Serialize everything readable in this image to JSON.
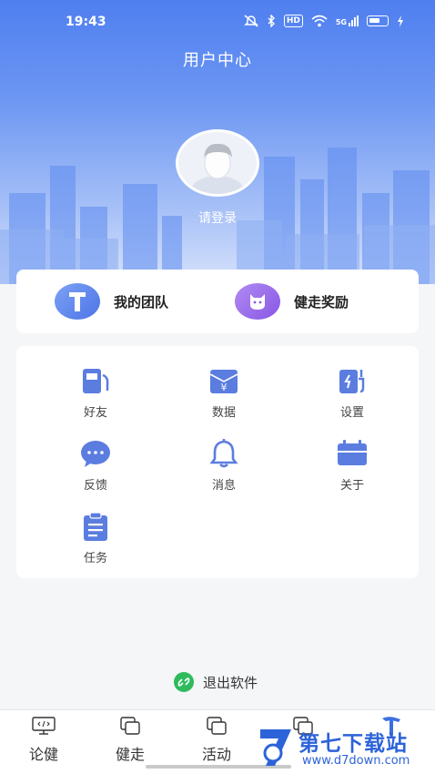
{
  "status_bar": {
    "time": "19:43",
    "icons": [
      "mute-icon",
      "bluetooth-icon",
      "hd-icon",
      "wifi-icon",
      "5g-signal-icon",
      "battery-icon",
      "charging-icon"
    ],
    "hd_label": "HD",
    "signal_label": "5G"
  },
  "header": {
    "title": "用户中心",
    "login_prompt": "请登录"
  },
  "quick_actions": [
    {
      "label": "我的团队",
      "icon": "team-t-icon"
    },
    {
      "label": "健走奖励",
      "icon": "reward-cat-icon"
    }
  ],
  "menu": [
    {
      "label": "好友",
      "icon": "friends-icon"
    },
    {
      "label": "数据",
      "icon": "data-yen-icon"
    },
    {
      "label": "设置",
      "icon": "settings-charger-icon"
    },
    {
      "label": "反馈",
      "icon": "feedback-chat-icon"
    },
    {
      "label": "消息",
      "icon": "bell-icon"
    },
    {
      "label": "关于",
      "icon": "calendar-icon"
    },
    {
      "label": "任务",
      "icon": "clipboard-icon"
    }
  ],
  "logout": {
    "label": "退出软件",
    "icon": "link-icon"
  },
  "tabbar": [
    {
      "label": "论健",
      "icon": "code-monitor-icon"
    },
    {
      "label": "健走",
      "icon": "cards-icon"
    },
    {
      "label": "活动",
      "icon": "cards-icon"
    },
    {
      "label": "",
      "icon": "cards-icon"
    },
    {
      "label": "",
      "icon": "hammer-icon"
    }
  ],
  "watermark": {
    "title": "第七下载站",
    "url": "www.d7down.com"
  },
  "colors": {
    "primary_blue": "#4f7ff0",
    "icon_blue": "#5b7de0",
    "logout_green": "#2dbb5d",
    "background": "#f5f6f8"
  }
}
